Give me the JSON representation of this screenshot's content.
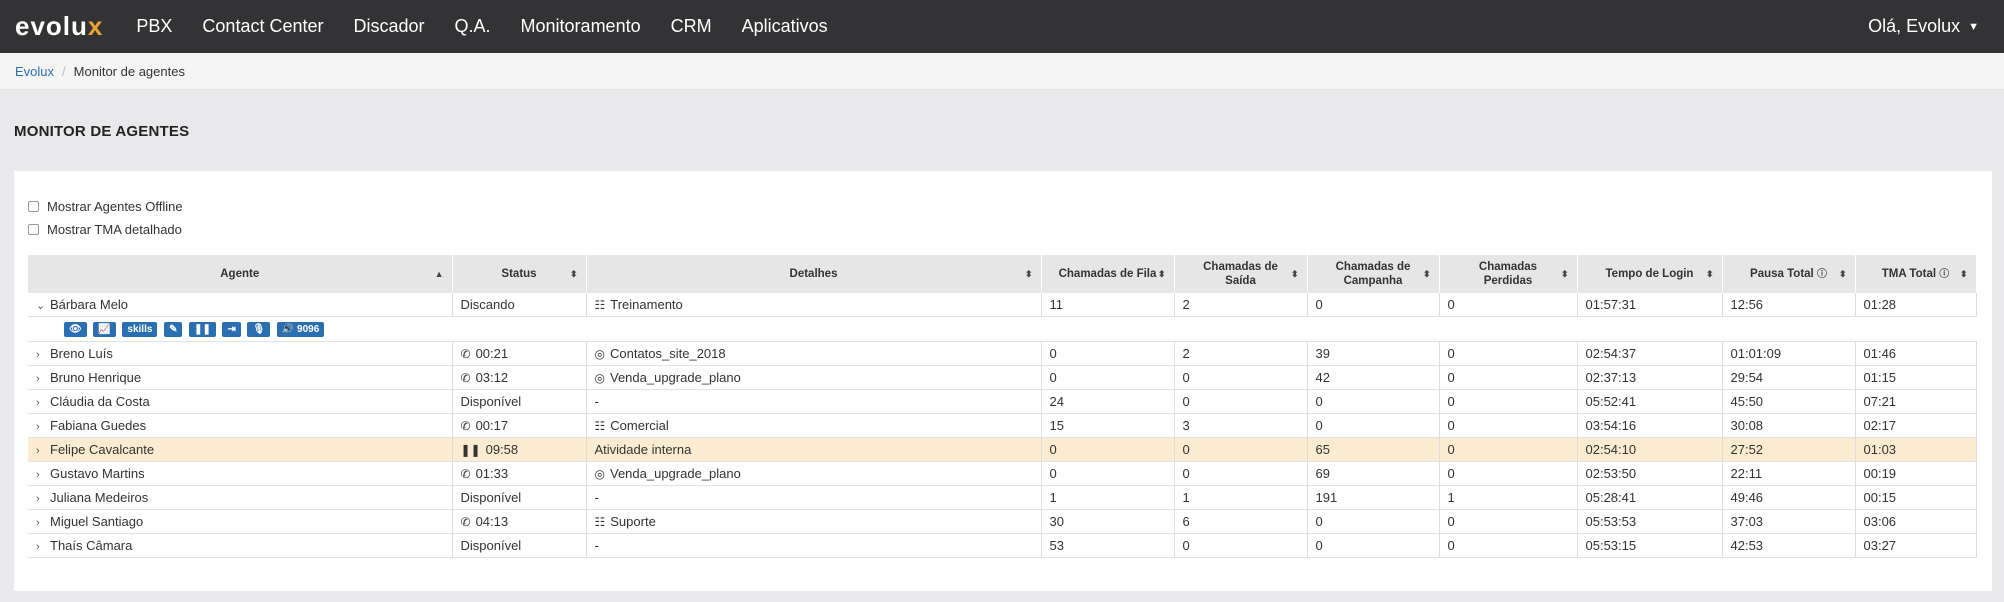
{
  "header": {
    "logo_main": "evolu",
    "logo_accent": "x",
    "menu": [
      "PBX",
      "Contact Center",
      "Discador",
      "Q.A.",
      "Monitoramento",
      "CRM",
      "Aplicativos"
    ],
    "user": "Olá, Evolux"
  },
  "breadcrumb": {
    "home": "Evolux",
    "current": "Monitor de agentes"
  },
  "page_title": "MONITOR DE AGENTES",
  "filters": {
    "offline": "Mostrar Agentes Offline",
    "tma": "Mostrar TMA detalhado"
  },
  "table": {
    "headers": [
      "Agente",
      "Status",
      "Detalhes",
      "Chamadas de Fila",
      "Chamadas de Saída",
      "Chamadas de Campanha",
      "Chamadas Perdidas",
      "Tempo de Login",
      "Pausa Total",
      "TMA Total"
    ],
    "expanded_buttons": [
      "skills",
      "9096"
    ],
    "rows": [
      {
        "agent": "Bárbara Melo",
        "status": "Discando",
        "status_icon": "",
        "details": "Treinamento",
        "details_icon": "queue",
        "fila": "11",
        "saida": "2",
        "campanha": "0",
        "perdidas": "0",
        "login": "01:57:31",
        "pausa": "12:56",
        "tma": "01:28"
      },
      {
        "agent": "Breno Luís",
        "status": "00:21",
        "status_icon": "phone",
        "details": "Contatos_site_2018",
        "details_icon": "target",
        "fila": "0",
        "saida": "2",
        "campanha": "39",
        "perdidas": "0",
        "login": "02:54:37",
        "pausa": "01:01:09",
        "tma": "01:46"
      },
      {
        "agent": "Bruno Henrique",
        "status": "03:12",
        "status_icon": "phone",
        "details": "Venda_upgrade_plano",
        "details_icon": "target",
        "fila": "0",
        "saida": "0",
        "campanha": "42",
        "perdidas": "0",
        "login": "02:37:13",
        "pausa": "29:54",
        "tma": "01:15"
      },
      {
        "agent": "Cláudia da Costa",
        "status": "Disponível",
        "status_icon": "",
        "details": "-",
        "details_icon": "",
        "fila": "24",
        "saida": "0",
        "campanha": "0",
        "perdidas": "0",
        "login": "05:52:41",
        "pausa": "45:50",
        "tma": "07:21"
      },
      {
        "agent": "Fabiana Guedes",
        "status": "00:17",
        "status_icon": "phone",
        "details": "Comercial",
        "details_icon": "queue",
        "fila": "15",
        "saida": "3",
        "campanha": "0",
        "perdidas": "0",
        "login": "03:54:16",
        "pausa": "30:08",
        "tma": "02:17"
      },
      {
        "agent": "Felipe Cavalcante",
        "status": "09:58",
        "status_icon": "pause",
        "details": "Atividade interna",
        "details_icon": "",
        "fila": "0",
        "saida": "0",
        "campanha": "65",
        "perdidas": "0",
        "login": "02:54:10",
        "pausa": "27:52",
        "tma": "01:03"
      },
      {
        "agent": "Gustavo Martins",
        "status": "01:33",
        "status_icon": "phone",
        "details": "Venda_upgrade_plano",
        "details_icon": "target",
        "fila": "0",
        "saida": "0",
        "campanha": "69",
        "perdidas": "0",
        "login": "02:53:50",
        "pausa": "22:11",
        "tma": "00:19"
      },
      {
        "agent": "Juliana Medeiros",
        "status": "Disponível",
        "status_icon": "",
        "details": "-",
        "details_icon": "",
        "fila": "1",
        "saida": "1",
        "campanha": "191",
        "perdidas": "1",
        "login": "05:28:41",
        "pausa": "49:46",
        "tma": "00:15"
      },
      {
        "agent": "Miguel Santiago",
        "status": "04:13",
        "status_icon": "phone",
        "details": "Suporte",
        "details_icon": "queue",
        "fila": "30",
        "saida": "6",
        "campanha": "0",
        "perdidas": "0",
        "login": "05:53:53",
        "pausa": "37:03",
        "tma": "03:06"
      },
      {
        "agent": "Thaís Câmara",
        "status": "Disponível",
        "status_icon": "",
        "details": "-",
        "details_icon": "",
        "fila": "53",
        "saida": "0",
        "campanha": "0",
        "perdidas": "0",
        "login": "05:53:15",
        "pausa": "42:53",
        "tma": "03:27"
      }
    ]
  },
  "colors": {
    "topbar": "#333335",
    "accent": "#e7a32e",
    "button": "#2b6fb3",
    "highlight": "#fbecd1"
  }
}
